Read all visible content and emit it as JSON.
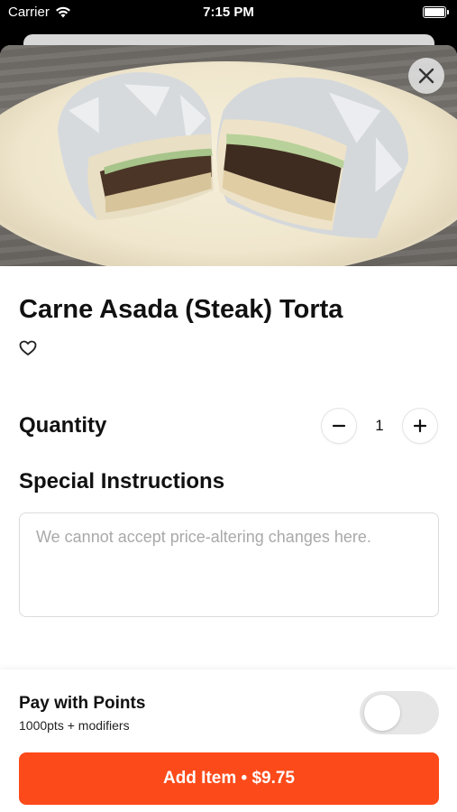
{
  "status_bar": {
    "carrier": "Carrier",
    "time": "7:15 PM"
  },
  "item": {
    "title": "Carne Asada (Steak) Torta"
  },
  "quantity": {
    "label": "Quantity",
    "value": "1"
  },
  "special_instructions": {
    "label": "Special Instructions",
    "placeholder": "We cannot accept price-altering changes here.",
    "value": ""
  },
  "points": {
    "title": "Pay with Points",
    "subtitle": "1000pts + modifiers",
    "enabled": false
  },
  "add_button": {
    "label": "Add Item • $9.75"
  },
  "icons": [
    "wifi-icon",
    "battery-icon",
    "close-icon",
    "heart-icon",
    "minus-icon",
    "plus-icon"
  ],
  "colors": {
    "accent": "#fc4a1a",
    "toggle_off": "#e6e6e6"
  }
}
